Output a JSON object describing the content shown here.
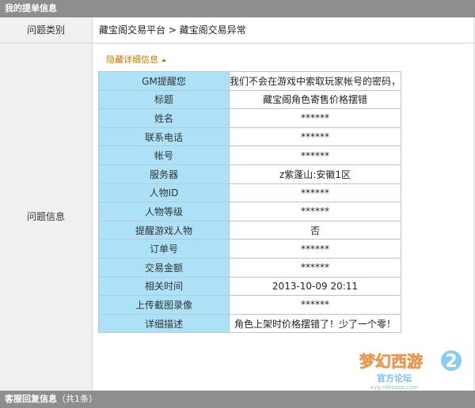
{
  "header_title": "我的提单信息",
  "problem_type": {
    "label": "问题类别",
    "value": "藏宝阁交易平台 > 藏宝阁交易异常"
  },
  "problem_info": {
    "label": "问题信息",
    "toggle_label": "隐藏详细信息",
    "rows": [
      {
        "key": "GM提醒您",
        "value": "我们不会在游戏中索取玩家帐号的密码，"
      },
      {
        "key": "标题",
        "value": "藏宝阁角色寄售价格摆错"
      },
      {
        "key": "姓名",
        "value": "******"
      },
      {
        "key": "联系电话",
        "value": "******"
      },
      {
        "key": "帐号",
        "value": "******"
      },
      {
        "key": "服务器",
        "value": "z紫蓬山:安徽1区"
      },
      {
        "key": "人物ID",
        "value": "******"
      },
      {
        "key": "人物等级",
        "value": "******"
      },
      {
        "key": "提醒游戏人物",
        "value": "否"
      },
      {
        "key": "订单号",
        "value": "******"
      },
      {
        "key": "交易金额",
        "value": "******"
      },
      {
        "key": "相关时间",
        "value": "2013-10-09 20:11"
      },
      {
        "key": "上传截图录像",
        "value": "******"
      },
      {
        "key": "详细描述",
        "value": "角色上架时价格摆错了！少了一个零！"
      }
    ]
  },
  "footer_header": {
    "title": "客服回复信息",
    "count": "（共1条）"
  },
  "watermark": {
    "logo_text": "梦幻西游",
    "logo_number": "2",
    "subtitle": "官方论坛",
    "url": "xyq.netease.com"
  },
  "colors": {
    "header_bg": "#8e8e8e",
    "key_cell_bg": "#ace1f8",
    "link": "#c27a00"
  }
}
